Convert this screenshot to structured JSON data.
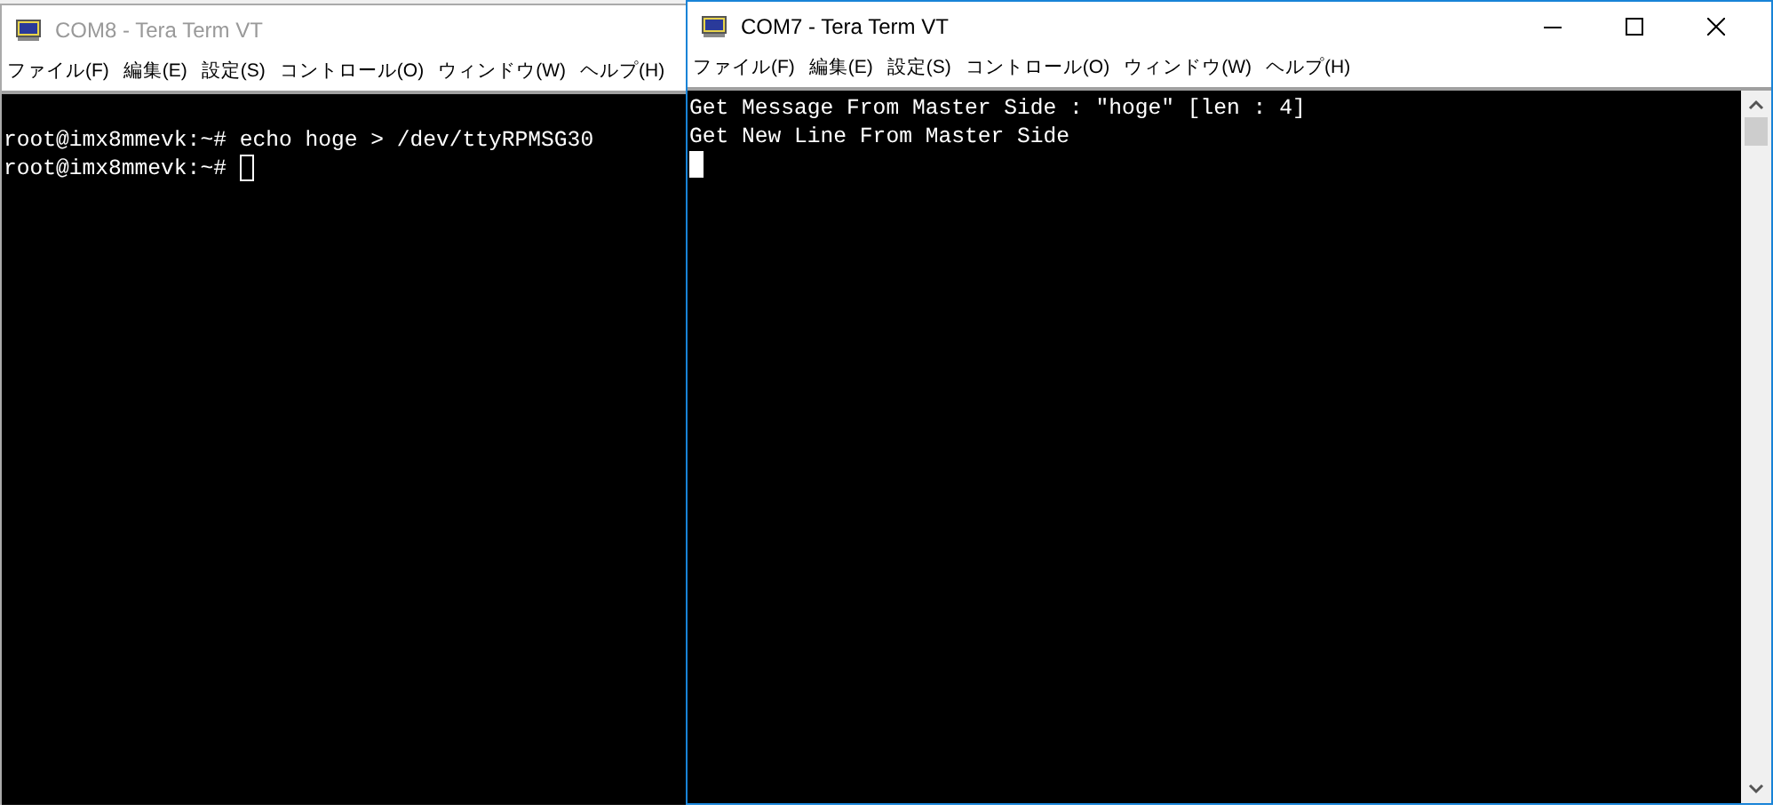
{
  "windows": [
    {
      "title": "COM8 - Tera Term VT",
      "active": false,
      "menu": [
        "ファイル(F)",
        "編集(E)",
        "設定(S)",
        "コントロール(O)",
        "ウィンドウ(W)",
        "ヘルプ(H)"
      ],
      "lines": [
        "root@imx8mmevk:~# echo hoge > /dev/ttyRPMSG30",
        "root@imx8mmevk:~# "
      ],
      "cursor_filled": false
    },
    {
      "title": "COM7 - Tera Term VT",
      "active": true,
      "menu": [
        "ファイル(F)",
        "編集(E)",
        "設定(S)",
        "コントロール(O)",
        "ウィンドウ(W)",
        "ヘルプ(H)"
      ],
      "lines": [
        "Get Message From Master Side : \"hoge\" [len : 4]",
        "Get New Line From Master Side"
      ],
      "cursor_filled": true
    }
  ]
}
